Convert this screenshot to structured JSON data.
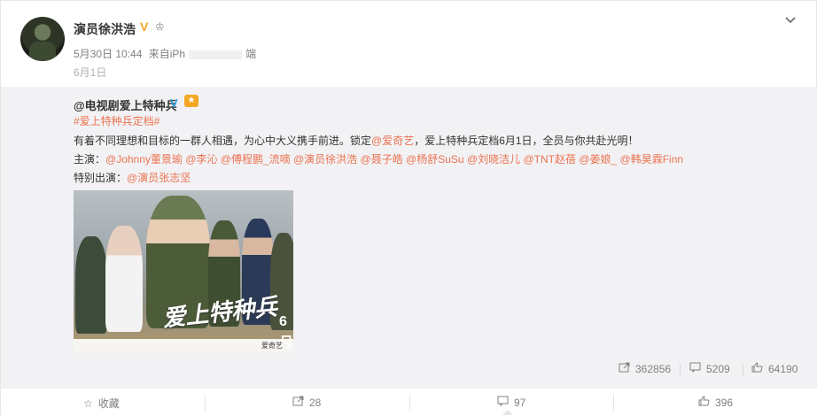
{
  "post": {
    "author": "演员徐洪浩",
    "verified_icon": "V",
    "crown_icon": "♔",
    "time": "5月30日 10:44",
    "source_prefix": "来自",
    "source_text": "iPh",
    "source_suffix": "端",
    "date_line": "6月1日"
  },
  "repost": {
    "author": "@电视剧爱上特种兵",
    "verified_icon": "V",
    "hashtag": "#爱上特种兵定档#",
    "body_prefix": "有着不同理想和目标的一群人相遇，为心中大义携手前进。锁定",
    "body_mention": "@爱奇艺",
    "body_suffix": "，爱上特种兵定档6月1日，全员与你共赴光明！",
    "cast_label": "主演：",
    "cast": [
      "@Johnny董景瑜",
      "@李沁",
      "@傅程鹏_流嘀",
      "@演员徐洪浩",
      "@聂子皓",
      "@杨舒SuSu",
      "@刘晓洁儿",
      "@TNT赵蓓",
      "@姜娘_",
      "@韩昊霖Finn"
    ],
    "special_label": "特别出演：",
    "special": "@演员张志坚",
    "poster_title": "爱上特种兵",
    "poster_date": "6月",
    "poster_brand": "爱奇艺",
    "stats": {
      "forward": "362856",
      "comment": "5209",
      "like": "64190"
    }
  },
  "footer": {
    "favorite": "收藏",
    "forward": "28",
    "comment": "97",
    "like": "396"
  },
  "colors": {
    "link": "#eb7350",
    "repost_bg": "#f2f2f5",
    "meta": "#808080"
  },
  "icons": {
    "forward": "share-icon",
    "comment": "comment-icon",
    "like": "thumbs-up-icon",
    "favorite": "star-icon",
    "menu": "chevron-down-icon"
  }
}
